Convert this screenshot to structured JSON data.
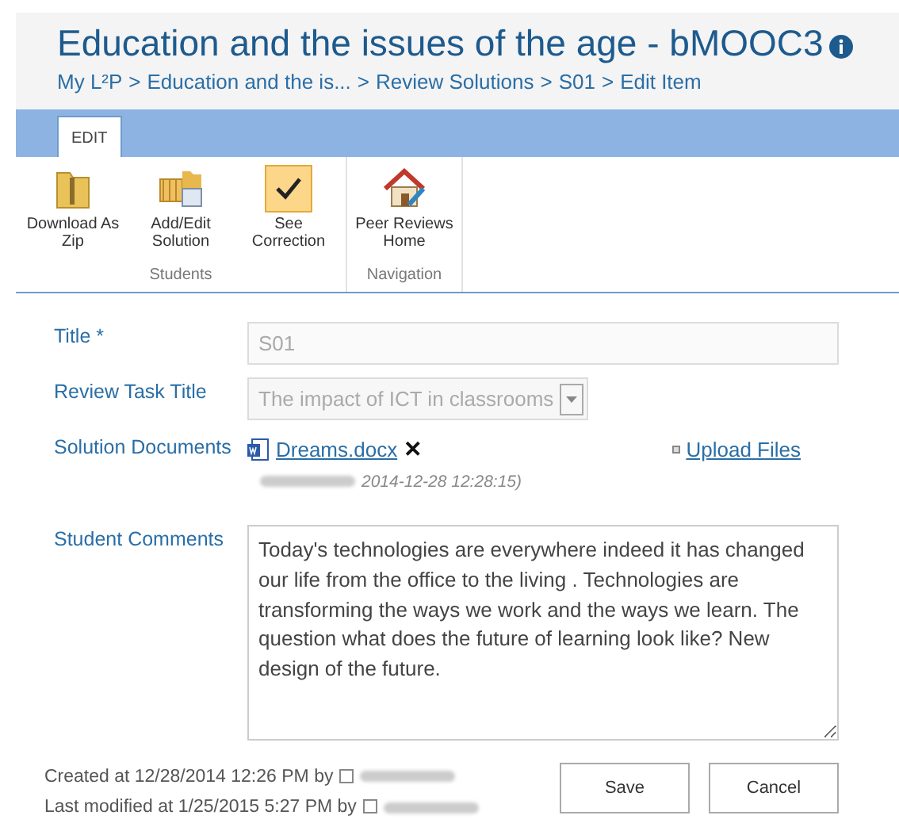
{
  "header": {
    "title": "Education and the issues of the age - bMOOC3",
    "breadcrumb": [
      {
        "label": "My L²P"
      },
      {
        "label": "Education and the is..."
      },
      {
        "label": "Review Solutions"
      },
      {
        "label": "S01"
      },
      {
        "label": "Edit Item"
      }
    ],
    "separator": ">"
  },
  "ribbon": {
    "tabs": [
      {
        "label": "EDIT",
        "selected": true
      }
    ],
    "groups": [
      {
        "label": "Students",
        "buttons": [
          {
            "kind": "zip",
            "label": "Download As Zip",
            "selected": false
          },
          {
            "kind": "solution",
            "label": "Add/Edit Solution",
            "selected": false
          },
          {
            "kind": "check",
            "label": "See Correction",
            "selected": true
          }
        ]
      },
      {
        "label": "Navigation",
        "buttons": [
          {
            "kind": "home",
            "label": "Peer Reviews Home",
            "selected": false
          }
        ]
      }
    ]
  },
  "form": {
    "fields": [
      {
        "kind": "text",
        "label": "Title *",
        "value": "S01",
        "disabled": true
      },
      {
        "kind": "select",
        "label": "Review Task Title",
        "value": "The impact of ICT in classrooms",
        "disabled": true
      },
      {
        "kind": "files",
        "label": "Solution Documents",
        "file": "Dreams.docx",
        "remove": "✕",
        "date": "2014-12-28 12:28:15)",
        "upload": "Upload Files"
      },
      {
        "kind": "textarea",
        "label": "Student Comments",
        "value": "Today's technologies are everywhere indeed it has changed our life from the office to the living . Technologies are transforming the ways we work and the ways we learn. The question what does the future of learning look like? New design of the future."
      }
    ]
  },
  "footer": {
    "created": "Created at 12/28/2014 12:26 PM  by",
    "modified": "Last modified at 1/25/2015 5:27 PM  by",
    "buttons": [
      "Save",
      "Cancel"
    ]
  }
}
